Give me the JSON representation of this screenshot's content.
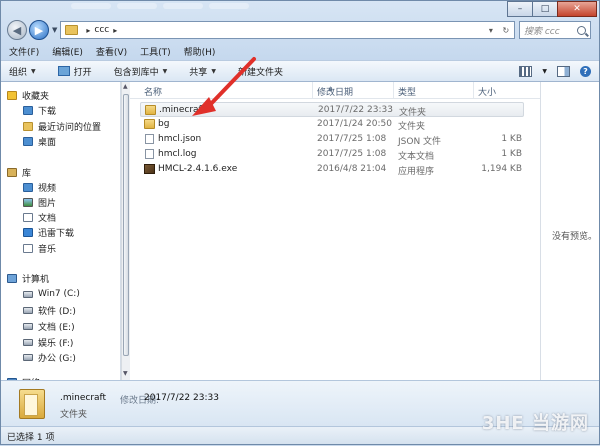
{
  "address": {
    "folder_name": "ccc"
  },
  "search": {
    "placeholder": "搜索 ccc"
  },
  "menubar": {
    "items": [
      "文件(F)",
      "编辑(E)",
      "查看(V)",
      "工具(T)",
      "帮助(H)"
    ]
  },
  "toolbar": {
    "organize": "组织",
    "open": "打开",
    "include_in_library": "包含到库中",
    "share": "共享",
    "new_folder": "新建文件夹"
  },
  "navpane": {
    "favorites": "收藏夹",
    "downloads": "下载",
    "recent": "最近访问的位置",
    "desktop": "桌面",
    "libraries": "库",
    "videos": "视频",
    "pictures": "图片",
    "documents": "文档",
    "thunder": "迅雷下载",
    "music": "音乐",
    "computer": "计算机",
    "drive_c": "Win7 (C:)",
    "drive_d": "软件 (D:)",
    "drive_e": "文档 (E:)",
    "drive_f": "娱乐 (F:)",
    "drive_g": "办公 (G:)",
    "network": "网络"
  },
  "columns": {
    "name": "名称",
    "modified": "修改日期",
    "type": "类型",
    "size": "大小"
  },
  "files": [
    {
      "name": ".minecraft",
      "date": "2017/7/22 23:33",
      "type": "文件夹",
      "size": ""
    },
    {
      "name": "bg",
      "date": "2017/1/24 20:50",
      "type": "文件夹",
      "size": ""
    },
    {
      "name": "hmcl.json",
      "date": "2017/7/25 1:08",
      "type": "JSON 文件",
      "size": "1 KB"
    },
    {
      "name": "hmcl.log",
      "date": "2017/7/25 1:08",
      "type": "文本文档",
      "size": "1 KB"
    },
    {
      "name": "HMCL-2.4.1.6.exe",
      "date": "2016/4/8 21:04",
      "type": "应用程序",
      "size": "1,194 KB"
    }
  ],
  "preview": {
    "empty_text": "没有预览。"
  },
  "details": {
    "name": ".minecraft",
    "date_label": "修改日期:",
    "date": "2017/7/22 23:33",
    "type": "文件夹"
  },
  "status": {
    "text": "已选择 1 项"
  },
  "watermark": {
    "text": "3HE 当游网"
  },
  "colors": {
    "selection": "#e8ecf0",
    "annotation_arrow": "#e0302a",
    "folder": "#e1b444"
  }
}
